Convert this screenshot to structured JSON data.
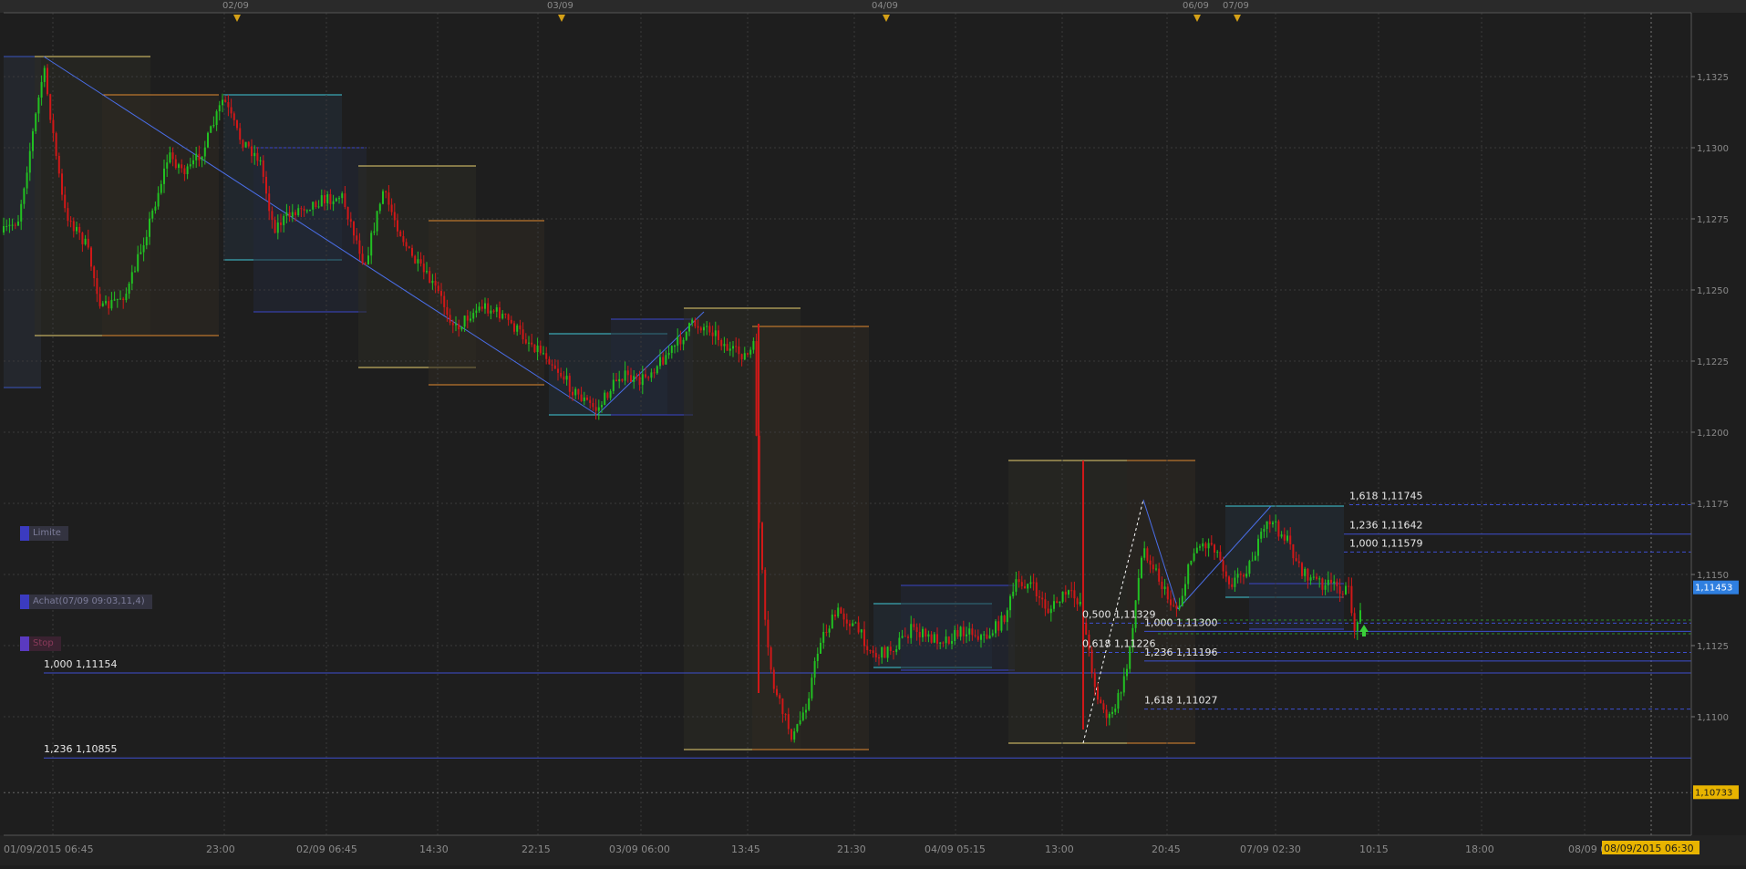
{
  "chart_data": {
    "type": "candlestick",
    "instrument_hint": "",
    "y_axis": {
      "min": 1.106,
      "max": 1.1345,
      "tick_labels": [
        "1,1325",
        "1,1300",
        "1,1275",
        "1,1250",
        "1,1225",
        "1,1200",
        "1,1175",
        "1,1150",
        "1,1125",
        "1,1100"
      ],
      "tick_values": [
        1.1325,
        1.13,
        1.1275,
        1.125,
        1.1225,
        1.12,
        1.1175,
        1.115,
        1.1125,
        1.11
      ]
    },
    "x_axis": {
      "tick_labels": [
        "01/09/2015 06:45",
        "23:00",
        "02/09 06:45",
        "14:30",
        "22:15",
        "03/09 06:00",
        "13:45",
        "21:30",
        "04/09 05:15",
        "13:00",
        "20:45",
        "07/09 02:30",
        "10:15",
        "18:00",
        "08/09 01:"
      ],
      "end_label": "08/09/2015 06:30"
    },
    "day_markers": [
      "02/09",
      "03/09",
      "04/09",
      "06/09",
      "07/09"
    ],
    "current_price": {
      "label": "1,11453",
      "value": 1.11453
    },
    "lower_price": {
      "label": "1,10733",
      "value": 1.10733
    },
    "fib_levels": [
      {
        "label": "1,618 1,11745",
        "value": 1.11745,
        "style": "dashed"
      },
      {
        "label": "1,236 1,11642",
        "value": 1.11642,
        "style": "solid"
      },
      {
        "label": "1,000 1,11579",
        "value": 1.11579,
        "style": "dashed"
      },
      {
        "label": "0,500 1,11329",
        "value": 1.11329,
        "style": "dashed"
      },
      {
        "label": "1,000 1,11300",
        "value": 1.113,
        "style": "solid"
      },
      {
        "label": "0,618 1,11226",
        "value": 1.11226,
        "style": "dashed"
      },
      {
        "label": "1,236 1,11196",
        "value": 1.11196,
        "style": "solid"
      },
      {
        "label": "1,000 1,11154",
        "value": 1.11154,
        "style": "solid"
      },
      {
        "label": "1,618 1,11027",
        "value": 1.11027,
        "style": "dashed"
      },
      {
        "label": "1,236 1,10855",
        "value": 1.10855,
        "style": "solid"
      }
    ],
    "order_tags": {
      "limit": "Limite",
      "buy": "Achat(07/09 09:03,11,4)",
      "stop": "Stop"
    },
    "colors": {
      "background": "#1e1e1e",
      "grid": "#3a3a3a",
      "up_candle": "#22c022",
      "down_candle": "#d01818",
      "level_line": "#3d4fd0",
      "current_price_bg": "#2f7fe0",
      "lower_price_bg": "#e8b400",
      "day_marker": "#d4a017"
    }
  }
}
